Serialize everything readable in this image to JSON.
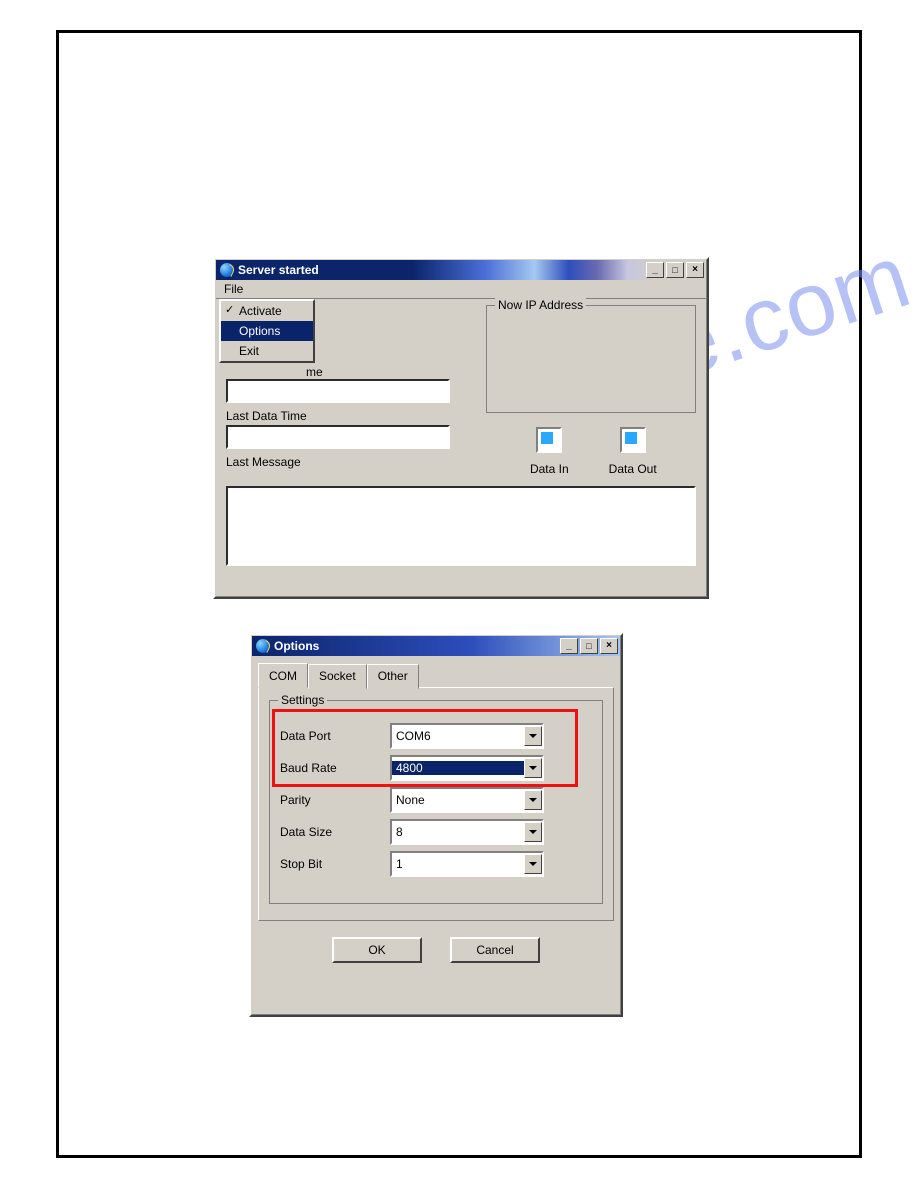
{
  "watermark": "manualshive.com",
  "window1": {
    "title": "Server started",
    "menu": {
      "file": "File"
    },
    "file_menu": {
      "activate": "Activate",
      "options": "Options",
      "exit": "Exit"
    },
    "labels": {
      "partial_time": "me",
      "last_data_time": "Last Data Time",
      "last_message": "Last Message",
      "now_ip": "Now IP Address",
      "data_in": "Data In",
      "data_out": "Data Out"
    }
  },
  "window2": {
    "title": "Options",
    "tabs": {
      "com": "COM",
      "socket": "Socket",
      "other": "Other"
    },
    "group": "Settings",
    "fields": {
      "data_port": {
        "label": "Data Port",
        "value": "COM6"
      },
      "baud_rate": {
        "label": "Baud Rate",
        "value": "4800"
      },
      "parity": {
        "label": "Parity",
        "value": "None"
      },
      "data_size": {
        "label": "Data Size",
        "value": "8"
      },
      "stop_bit": {
        "label": "Stop Bit",
        "value": "1"
      }
    },
    "buttons": {
      "ok": "OK",
      "cancel": "Cancel"
    }
  }
}
